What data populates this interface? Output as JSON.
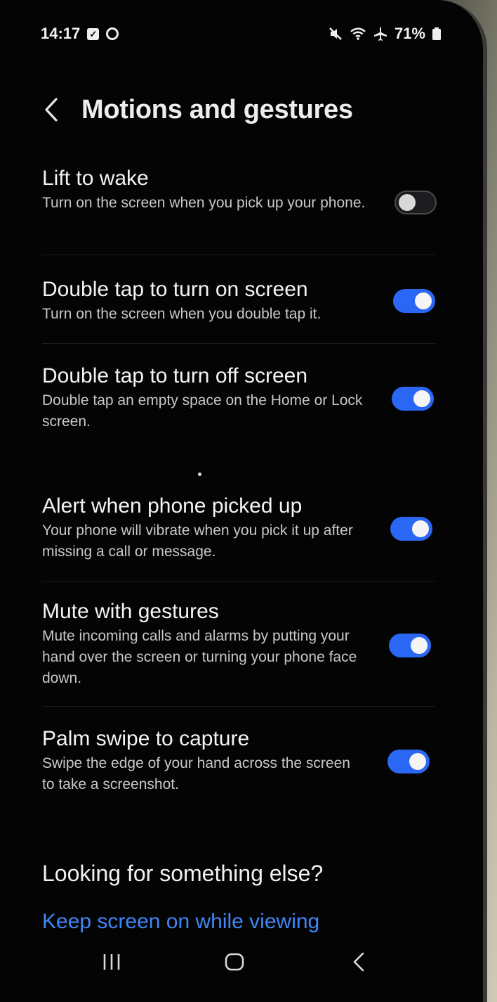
{
  "status_bar": {
    "time": "14:17",
    "left_icons": [
      "check-notification-icon",
      "circle-notification-icon"
    ],
    "right_icons": [
      "mute-icon",
      "wifi-icon",
      "airplane-icon"
    ],
    "battery": "71%"
  },
  "header": {
    "back_icon": "chevron-left-icon",
    "title": "Motions and gestures"
  },
  "settings": [
    {
      "title": "Lift to wake",
      "description": "Turn on the screen when you pick up your phone.",
      "enabled": false
    },
    {
      "title": "Double tap to turn on screen",
      "description": "Turn on the screen when you double tap it.",
      "enabled": true
    },
    {
      "title": "Double tap to turn off screen",
      "description": "Double tap an empty space on the Home or Lock screen.",
      "enabled": true
    },
    {
      "title": "Alert when phone picked up",
      "description": "Your phone will vibrate when you pick it up after missing a call or message.",
      "enabled": true
    },
    {
      "title": "Mute with gestures",
      "description": "Mute incoming calls and alarms by putting your hand over the screen or turning your phone face down.",
      "enabled": true
    },
    {
      "title": "Palm swipe to capture",
      "description": "Swipe the edge of your hand across the screen to take a screenshot.",
      "enabled": true
    }
  ],
  "looking": {
    "title": "Looking for something else?",
    "link": "Keep screen on while viewing"
  },
  "nav_bar": {
    "icons": [
      "recents-icon",
      "home-icon",
      "back-icon"
    ]
  },
  "colors": {
    "background": "#040405",
    "toggle_on": "#2a67f4",
    "link": "#3f86f6"
  }
}
